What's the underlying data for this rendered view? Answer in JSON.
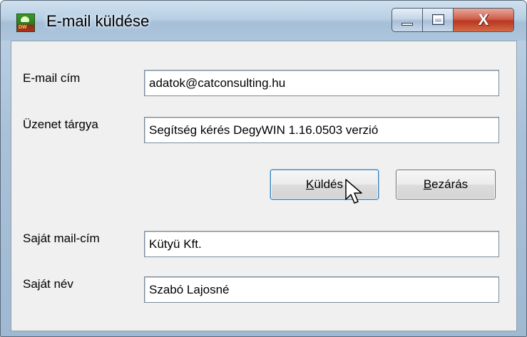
{
  "window": {
    "title": "E-mail küldése",
    "app_icon_text": "DW",
    "icons": {
      "app": "degywin-app-icon",
      "minimize": "minimize-icon",
      "maximize": "maximize-icon",
      "close": "close-icon",
      "cursor": "mouse-pointer-icon"
    },
    "close_glyph": "X"
  },
  "form": {
    "email_label": "E-mail cím",
    "email_value": "adatok@catconsulting.hu",
    "subject_label": "Üzenet tárgya",
    "subject_value": "Segítség kérés DegyWIN 1.16.0503 verzió",
    "own_mail_label": "Saját mail-cím",
    "own_mail_value": "Kütyü Kft.",
    "own_name_label": "Saját név",
    "own_name_value": "Szabó Lajosné"
  },
  "buttons": {
    "send_accel": "K",
    "send_rest": "üldés",
    "close_accel": "B",
    "close_rest": "ezárás"
  },
  "colors": {
    "titlebar": "#b8cfe4",
    "close_button": "#c8452a",
    "client_bg": "#f0f0f0"
  }
}
